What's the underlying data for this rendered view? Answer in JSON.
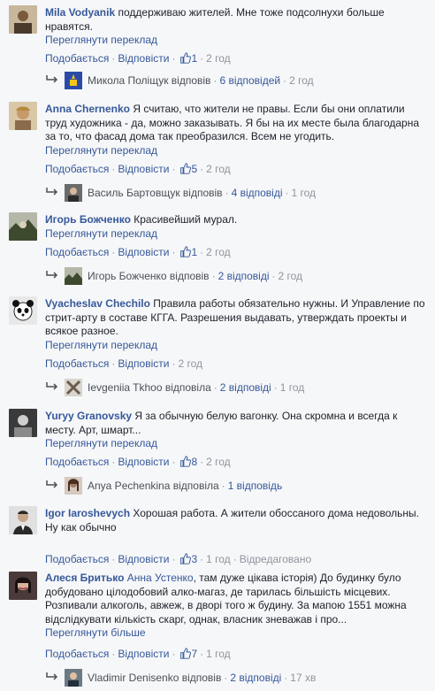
{
  "comments": [
    {
      "author": "Mila Vodyanik",
      "text": "поддерживаю жителей. Мне тоже подсолнухи больше нравятся.",
      "translate": "Переглянути переклад",
      "like": "Подобається",
      "reply": "Відповісти",
      "likes": "1",
      "time": "2 год",
      "reply_author": "Микола Поліщук відповів",
      "reply_count": "6 відповідей",
      "reply_time": "2 год"
    },
    {
      "author": "Anna Chernenko",
      "text": "Я считаю, что жители не правы. Если бы они оплатили труд художника - да, можно заказывать. Я бы на их месте была благодарна за то, что фасад дома так преобразился. Всем не угодить.",
      "translate": "Переглянути переклад",
      "like": "Подобається",
      "reply": "Відповісти",
      "likes": "5",
      "time": "2 год",
      "reply_author": "Василь Бартовщук відповів",
      "reply_count": "4 відповіді",
      "reply_time": "1 год"
    },
    {
      "author": "Игорь Божченко",
      "text": "Красивейший мурал.",
      "translate": "Переглянути переклад",
      "like": "Подобається",
      "reply": "Відповісти",
      "likes": "1",
      "time": "2 год",
      "reply_author": "Игорь Божченко відповів",
      "reply_count": "2 відповіді",
      "reply_time": "2 год"
    },
    {
      "author": "Vyacheslav Chechilo",
      "text": "Правила работы обязательно нужны. И Управление по стрит-арту в составе КГГА. Разрешения выдавать, утверждать проекты и всякое разное.",
      "translate": "Переглянути переклад",
      "like": "Подобається",
      "reply": "Відповісти",
      "likes": "",
      "time": "2 год",
      "reply_author": "Ievgeniia Tkhoo відповіла",
      "reply_count": "2 відповіді",
      "reply_time": "1 год"
    },
    {
      "author": "Yuryy Granovsky",
      "text": "Я за обычную белую вагонку. Она скромна и всегда к месту. Арт, шмарт...",
      "translate": "Переглянути переклад",
      "like": "Подобається",
      "reply": "Відповісти",
      "likes": "8",
      "time": "2 год",
      "reply_author": "Anya Pechenkina відповіла",
      "reply_count": "1 відповідь",
      "reply_time": ""
    },
    {
      "author": "Igor Iaroshevych",
      "text": "Хорошая работа. А жители обоссаного дома недовольны. Ну как обычно",
      "translate": "",
      "like": "Подобається",
      "reply": "Відповісти",
      "likes": "3",
      "time": "1 год",
      "edited": "Відредаговано",
      "reply_author": "",
      "reply_count": "",
      "reply_time": ""
    },
    {
      "author": "Алеся Бритько",
      "mention": "Анна Устенко",
      "text": ", там дуже цікава історія) До будинку було добудовано цілодобовий алко-магаз, де тарилась більшість місцевих. Розпивали алкоголь, авжеж, в дворі того ж будину. За мапою 1551 можна відслідкувати кількість скарг, однак, власник зневажав і про...",
      "translate": "Переглянути більше",
      "like": "Подобається",
      "reply": "Відповісти",
      "likes": "7",
      "time": "1 год",
      "reply_author": "Vladimir Denisenko відповів",
      "reply_count": "2 відповіді",
      "reply_time": "17 хв"
    }
  ],
  "colors": {
    "link": "#365899",
    "muted": "#90949c",
    "text": "#1d2129",
    "background": "#f6f7f9"
  }
}
